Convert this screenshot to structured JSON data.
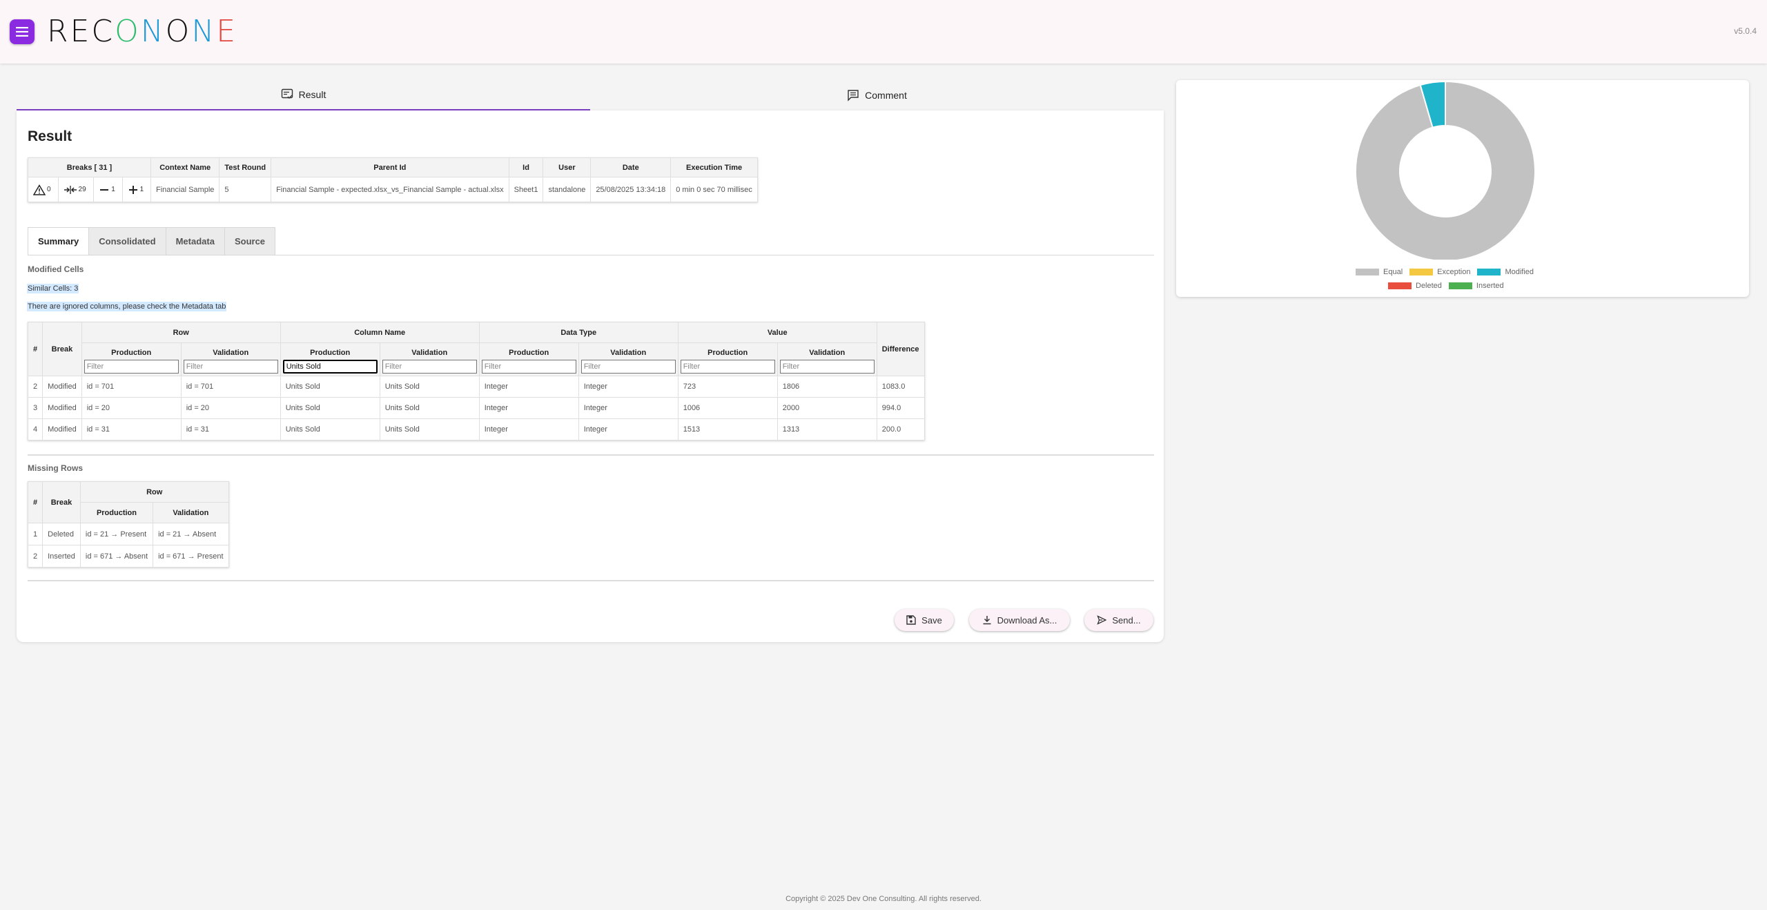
{
  "header": {
    "logo_parts": [
      "REC",
      "O",
      "N",
      "O",
      "N",
      "E"
    ],
    "version": "v5.0.4"
  },
  "tabs": [
    {
      "label": "Result",
      "icon": "result-icon",
      "active": true
    },
    {
      "label": "Comment",
      "icon": "comment-icon",
      "active": false
    }
  ],
  "result": {
    "title": "Result",
    "summary_headers": [
      "Breaks [ 31 ]",
      "Context Name",
      "Test Round",
      "Parent Id",
      "Id",
      "User",
      "Date",
      "Execution Time"
    ],
    "breaks": [
      {
        "icon": "warning-icon",
        "symbol": "⚠",
        "count": "0"
      },
      {
        "icon": "merge-arrows-icon",
        "symbol": "⇥⇤",
        "count": "29"
      },
      {
        "icon": "minus-icon",
        "symbol": "−",
        "count": "1"
      },
      {
        "icon": "plus-icon",
        "symbol": "+",
        "count": "1"
      }
    ],
    "summary_values": {
      "context_name": "Financial Sample",
      "test_round": "5",
      "parent_id": "Financial Sample - expected.xlsx_vs_Financial Sample - actual.xlsx",
      "id": "Sheet1",
      "user": "standalone",
      "date": "25/08/2025 13:34:18",
      "execution_time": "0 min 0 sec 70 millisec"
    }
  },
  "subtabs": [
    "Summary",
    "Consolidated",
    "Metadata",
    "Source"
  ],
  "modified": {
    "title": "Modified Cells",
    "similar": "Similar Cells: 3",
    "note": "There are ignored columns, please check the Metadata tab",
    "group_headers": [
      "#",
      "Break",
      "Row",
      "Column Name",
      "Data Type",
      "Value",
      "Difference"
    ],
    "sub_headers": [
      "Production",
      "Validation"
    ],
    "filter_placeholder": "Filter",
    "filter_values": [
      "",
      "",
      "Units Sold",
      "",
      "",
      "",
      "",
      ""
    ],
    "rows": [
      [
        "2",
        "Modified",
        "id = 701",
        "id = 701",
        "Units Sold",
        "Units Sold",
        "Integer",
        "Integer",
        "723",
        "1806",
        "1083.0"
      ],
      [
        "3",
        "Modified",
        "id = 20",
        "id = 20",
        "Units Sold",
        "Units Sold",
        "Integer",
        "Integer",
        "1006",
        "2000",
        "994.0"
      ],
      [
        "4",
        "Modified",
        "id = 31",
        "id = 31",
        "Units Sold",
        "Units Sold",
        "Integer",
        "Integer",
        "1513",
        "1313",
        "200.0"
      ]
    ]
  },
  "missing": {
    "title": "Missing Rows",
    "headers": [
      "#",
      "Break",
      "Row",
      "Production",
      "Validation"
    ],
    "rows": [
      [
        "1",
        "Deleted",
        "id = 21 → Present",
        "id = 21 → Absent"
      ],
      [
        "2",
        "Inserted",
        "id = 671 → Absent",
        "id = 671 → Present"
      ]
    ]
  },
  "actions": {
    "save": "Save",
    "download": "Download As...",
    "send": "Send..."
  },
  "chart_data": {
    "type": "pie",
    "donut": true,
    "categories": [
      "Equal",
      "Exception",
      "Modified",
      "Deleted",
      "Inserted"
    ],
    "values": [
      95.5,
      0,
      4.5,
      0,
      0
    ],
    "colors": [
      "#c2c2c2",
      "#f5c842",
      "#1fb4c9",
      "#e84d3d",
      "#4caf50"
    ],
    "legend_position": "bottom"
  },
  "footer": "Copyright © 2025 Dev One Consulting. All rights reserved."
}
